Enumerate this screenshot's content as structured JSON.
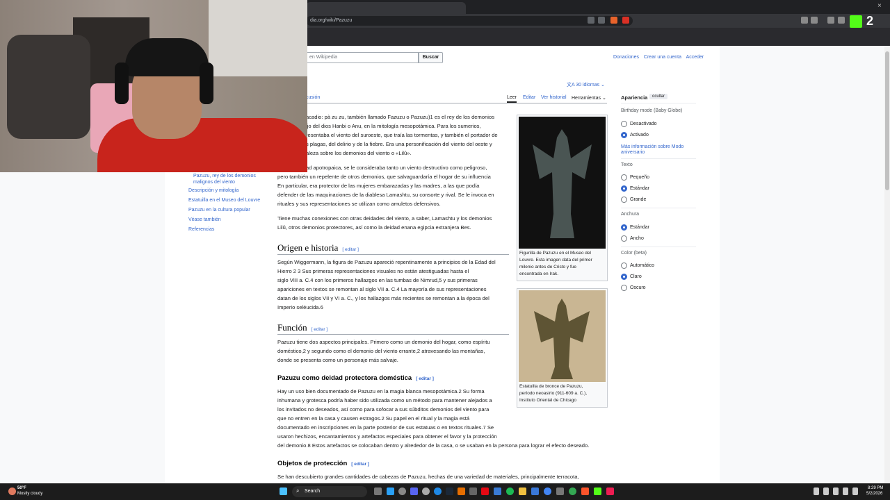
{
  "browser": {
    "url": "dia.org/wiki/Pazuzu",
    "stream_badge": "2",
    "close_glyph": "×"
  },
  "header": {
    "search_placeholder": "en Wikipedia",
    "search_button": "Buscar",
    "links": [
      "Donaciones",
      "Crear una cuenta",
      "Acceder"
    ]
  },
  "article": {
    "title_fragment": "I",
    "langs": "30 idiomas",
    "discussion_fragment": "cusión",
    "tabs": [
      "Leer",
      "Editar",
      "Ver historial",
      "Herramientas"
    ],
    "intro_lines": [
      "acadio: pà zu zu, también llamado Fazuzu o Pazuzu)1 es el rey de los demonios",
      "ijo del dios Hanbi o Anu, en la mitología mesopotámica. Para los sumerios,",
      "resentaba el viento del suroeste, que traía las tormentas, y también el portador de",
      "s plagas, del delirio y de la fiebre. Era una personificación del viento del oeste y",
      "aleza sobre los demonios del viento o «Lilû»."
    ],
    "p2_first": "ad apotropaica, se le consideraba tanto un viento destructivo como peligroso,",
    "p2_lines": [
      "pero también un repelente de otros demonios, que salvaguardaría el hogar de su influencia",
      "En particular, era protector de las mujeres embarazadas y las madres, a las que podía",
      "defender de las maquinaciones de la diablesa Lamashtu, su consorte y rival. Se le invoca en",
      "rituales y sus representaciones se utilizan como amuletos defensivos."
    ],
    "p3_lines": [
      "Tiene muchas conexiones con otras deidades del viento, a saber, Lamashtu y los demonios",
      "Lilû, otros demonios protectores, así como la deidad enana egipcia extranjera Bes."
    ],
    "h_origen": "Origen e historia",
    "origen_lines": [
      "Según Wiggermann, la figura de Pazuzu apareció repentinamente a principios de la Edad del",
      "Hierro 2 3 Sus primeras representaciones visuales no están atestiguadas hasta el",
      "siglo VIII a. C.4 con los primeros hallazgos en las tumbas de Nimrud,5 y sus primeras",
      "apariciones en textos se remontan al siglo VII a. C.4 La mayoría de sus representaciones",
      "datan de los siglos VII y VI a. C., y los hallazgos más recientes se remontan a la época del",
      "Imperio seléucida.6"
    ],
    "h_funcion": "Función",
    "funcion_lines": [
      "Pazuzu tiene dos aspectos principales. Primero como un demonio del hogar, como espíritu",
      "doméstico,2 y segundo como el demonio del viento errante,2 atravesando las montañas,",
      "donde se presenta como un personaje más salvaje."
    ],
    "h_deidad": "Pazuzu como deidad protectora doméstica",
    "deidad_lines": [
      "Hay un uso bien documentado de Pazuzu en la magia blanca mesopotámica.2 Su forma",
      "inhumana y grotesca podría haber sido utilizada como un método para mantener alejados a",
      "los invitados no deseados, así como para sofocar a sus súbditos demonios del viento para",
      "que no entren en la casa y causen estragos.2 Su papel en el ritual y la magia está",
      "documentado en inscripciones en la parte posterior de sus estatuas o en textos rituales.7 Se",
      "usaron hechizos, encantamientos y artefactos especiales para obtener el favor y la protección",
      "del demonio.8 Estos artefactos se colocaban dentro y alrededor de la casa, o se usaban en la persona para lograr el efecto deseado."
    ],
    "h_objetos": "Objetos de protección",
    "objetos_line": "Se han descubierto grandes cantidades de cabezas de Pazuzu, hechas de una variedad de materiales, principalmente terracota,",
    "edit_label": "editar"
  },
  "toc": [
    "Pazuzu, rey de los demonios",
    "malignos del viento",
    "Descripción y mitología",
    "Estatuilla en el Museo del Louvre",
    "Pazuzu en la cultura popular",
    "Véase también",
    "Referencias"
  ],
  "figures": [
    {
      "caption": [
        "Figurilla de Pazuzu en el Museo del",
        "Louvre. Esta imagen data del primer",
        "milenio antes de Cristo y fue",
        "encontrada en Irak."
      ]
    },
    {
      "caption": [
        "Estatuilla de bronce de Pazuzu,",
        "período neoasirio (911-609 a. C.),",
        "Instituto Oriental de Chicago"
      ]
    }
  ],
  "appearance": {
    "title": "Apariencia",
    "hide": "ocultar",
    "birthday_label": "Birthday mode (Baby Globe)",
    "birthday_options": [
      "Desactivado",
      "Activado"
    ],
    "birthday_selected": 1,
    "more_info": [
      "Más información sobre Modo",
      "aniversario"
    ],
    "text_label": "Texto",
    "text_options": [
      "Pequeño",
      "Estándar",
      "Grande"
    ],
    "text_selected": 1,
    "width_label": "Anchura",
    "width_options": [
      "Estándar",
      "Ancho"
    ],
    "width_selected": 0,
    "color_label": "Color (beta)",
    "color_options": [
      "Automático",
      "Claro",
      "Oscuro"
    ],
    "color_selected": 1
  },
  "taskbar": {
    "weather_temp": "50°F",
    "weather_desc": "Mostly cloudy",
    "search": "Search",
    "time": "8:29 PM",
    "date": "5/2/2026"
  },
  "colors": {
    "link": "#3366cc",
    "radio_on": "#3366cc",
    "stream_logo": "#53fc18"
  }
}
